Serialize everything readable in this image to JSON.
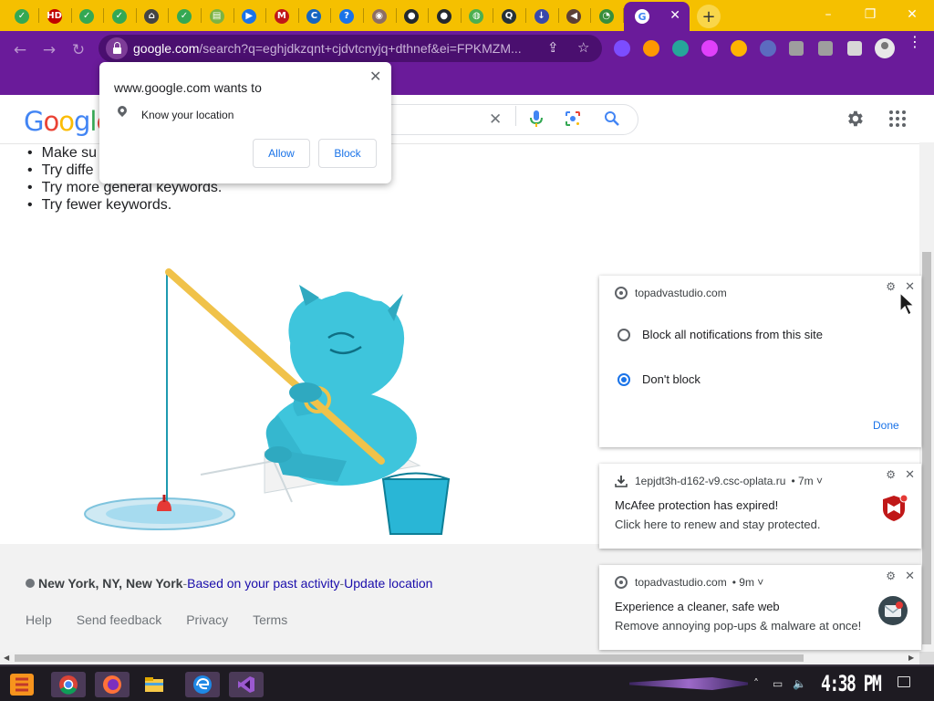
{
  "browser": {
    "tab_favicons": [
      {
        "icon": "check-circle-icon",
        "color": "#34a853",
        "glyph": "✓"
      },
      {
        "icon": "hd-icon",
        "color": "#c00000",
        "glyph": "HD"
      },
      {
        "icon": "check-circle-icon",
        "color": "#34a853",
        "glyph": "✓"
      },
      {
        "icon": "check-circle-icon",
        "color": "#34a853",
        "glyph": "✓"
      },
      {
        "icon": "home-alert-icon",
        "color": "#444444",
        "glyph": "⌂"
      },
      {
        "icon": "check-circle-icon",
        "color": "#34a853",
        "glyph": "✓"
      },
      {
        "icon": "sheet-icon",
        "color": "#7cb342",
        "glyph": "▤"
      },
      {
        "icon": "play-store-icon",
        "color": "#1a73e8",
        "glyph": "▶"
      },
      {
        "icon": "mcafee-shield-icon",
        "color": "#c01818",
        "glyph": "M"
      },
      {
        "icon": "cloud-icon",
        "color": "#1565c0",
        "glyph": "C"
      },
      {
        "icon": "help-icon",
        "color": "#1a73e8",
        "glyph": "?"
      },
      {
        "icon": "planet-icon",
        "color": "#8d6e63",
        "glyph": "◉"
      },
      {
        "icon": "github-icon",
        "color": "#24292e",
        "glyph": "●"
      },
      {
        "icon": "github-icon",
        "color": "#24292e",
        "glyph": "●"
      },
      {
        "icon": "earth-icon",
        "color": "#4caf50",
        "glyph": "◍"
      },
      {
        "icon": "magnifier-box-icon",
        "color": "#263238",
        "glyph": "Q"
      },
      {
        "icon": "download-icon",
        "color": "#3949ab",
        "glyph": "↓"
      },
      {
        "icon": "speaker-icon",
        "color": "#5d4037",
        "glyph": "◀"
      },
      {
        "icon": "chart-clock-icon",
        "color": "#388e3c",
        "glyph": "◔"
      }
    ],
    "active_tab": {
      "favicon": "google-icon",
      "glyph": "G",
      "close_glyph": "✕"
    },
    "new_tab_glyph": "+",
    "window_controls": {
      "minimize": "–",
      "maximize": "❐",
      "close": "✕"
    },
    "nav": {
      "back": "←",
      "forward": "→",
      "reload": "↻"
    },
    "url_host": "google.com",
    "url_rest": "/search?q=eghjdkzqnt+cjdvtcnyjq+dthnef&ei=FPKMZM...",
    "omnibox_share_glyph": "⇪",
    "omnibox_star_glyph": "☆",
    "extensions": [
      {
        "name": "ext-toucan-icon",
        "color": "#7c4dff"
      },
      {
        "name": "ext-orange-ring-icon",
        "color": "#ff9800"
      },
      {
        "name": "ext-colorwheel-icon",
        "color": "#26a69a"
      },
      {
        "name": "ext-orb-icon",
        "color": "#e040fb"
      },
      {
        "name": "ext-chart-icon",
        "color": "#ffb300"
      },
      {
        "name": "ext-edit-icon",
        "color": "#5c6bc0"
      },
      {
        "name": "puzzle-icon",
        "color": "#9e9e9e"
      },
      {
        "name": "reading-list-icon",
        "color": "#9e9e9e"
      },
      {
        "name": "side-panel-icon",
        "color": "#d7d7d7"
      }
    ],
    "menu_glyph": "⋮",
    "theme_color": "#6a1b9a",
    "tabstrip_color": "#f5c000"
  },
  "google": {
    "logo_letters": [
      {
        "ch": "G",
        "color": "#4285f4"
      },
      {
        "ch": "o",
        "color": "#ea4335"
      },
      {
        "ch": "o",
        "color": "#fbbc05"
      },
      {
        "ch": "g",
        "color": "#4285f4"
      },
      {
        "ch": "l",
        "color": "#34a853"
      },
      {
        "ch": "e",
        "color": "#ea4335"
      }
    ],
    "search_clear_glyph": "✕",
    "suggestions": [
      "Make su",
      "Try diffe",
      "Try more general keywords.",
      "Try fewer keywords."
    ],
    "footer": {
      "city": "New York, NY, New York",
      "sep1": " - ",
      "based_on": "Based on your past activity",
      "sep2": " - ",
      "update": "Update location",
      "links": [
        "Help",
        "Send feedback",
        "Privacy",
        "Terms"
      ]
    }
  },
  "permission_popup": {
    "title": "www.google.com wants to",
    "item": "Know your location",
    "allow": "Allow",
    "block": "Block",
    "close_glyph": "✕"
  },
  "notifications": {
    "settings_card": {
      "site": "topadvastudio.com",
      "options": [
        "Block all notifications from this site",
        "Don't block"
      ],
      "selected_index": 1,
      "done": "Done"
    },
    "mcafee_card": {
      "site": "1epjdt3h-d162-v9.csc-oplata.ru",
      "age": "• 7m ˅",
      "title": "McAfee protection has expired!",
      "message": "Click here to renew and stay protected."
    },
    "web_card": {
      "site": "topadvastudio.com",
      "age": "• 9m ˅",
      "title": "Experience a cleaner, safe web",
      "message": "Remove annoying pop-ups & malware at once!"
    },
    "gear_glyph": "⚙",
    "close_glyph": "✕"
  },
  "taskbar": {
    "apps": [
      "chrome-icon",
      "firefox-icon",
      "file-explorer-icon",
      "edge-icon",
      "visual-studio-icon"
    ],
    "tray_chevron": "˄",
    "tray_network": "▭",
    "tray_volume": "🔈",
    "clock": "4:38 PM"
  }
}
